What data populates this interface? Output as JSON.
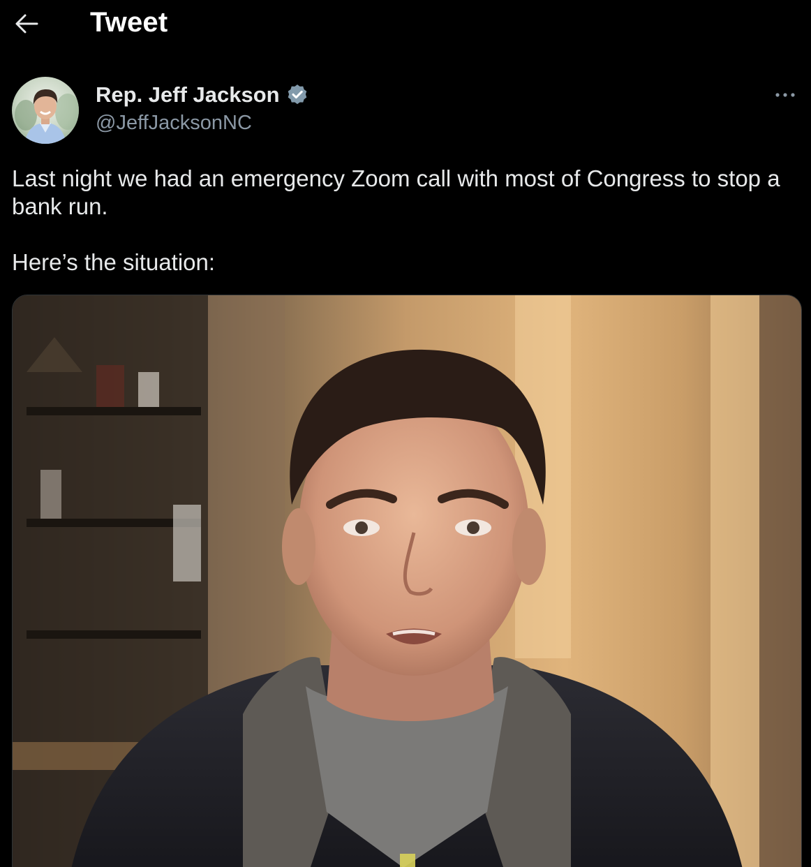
{
  "header": {
    "title": "Tweet",
    "back_icon": "arrow-left-icon"
  },
  "author": {
    "display_name": "Rep. Jeff Jackson",
    "handle": "@JeffJacksonNC",
    "verified_icon": "verified-badge-icon",
    "more_icon": "ellipsis-icon"
  },
  "tweet": {
    "line1": "Last night we had an emergency Zoom call with most of Congress to stop a bank run.",
    "line2": "Here’s the situation:"
  },
  "colors": {
    "background": "#000000",
    "text": "#e7e9ea",
    "secondary_text": "#8b98a5",
    "verified": "#829aab"
  }
}
